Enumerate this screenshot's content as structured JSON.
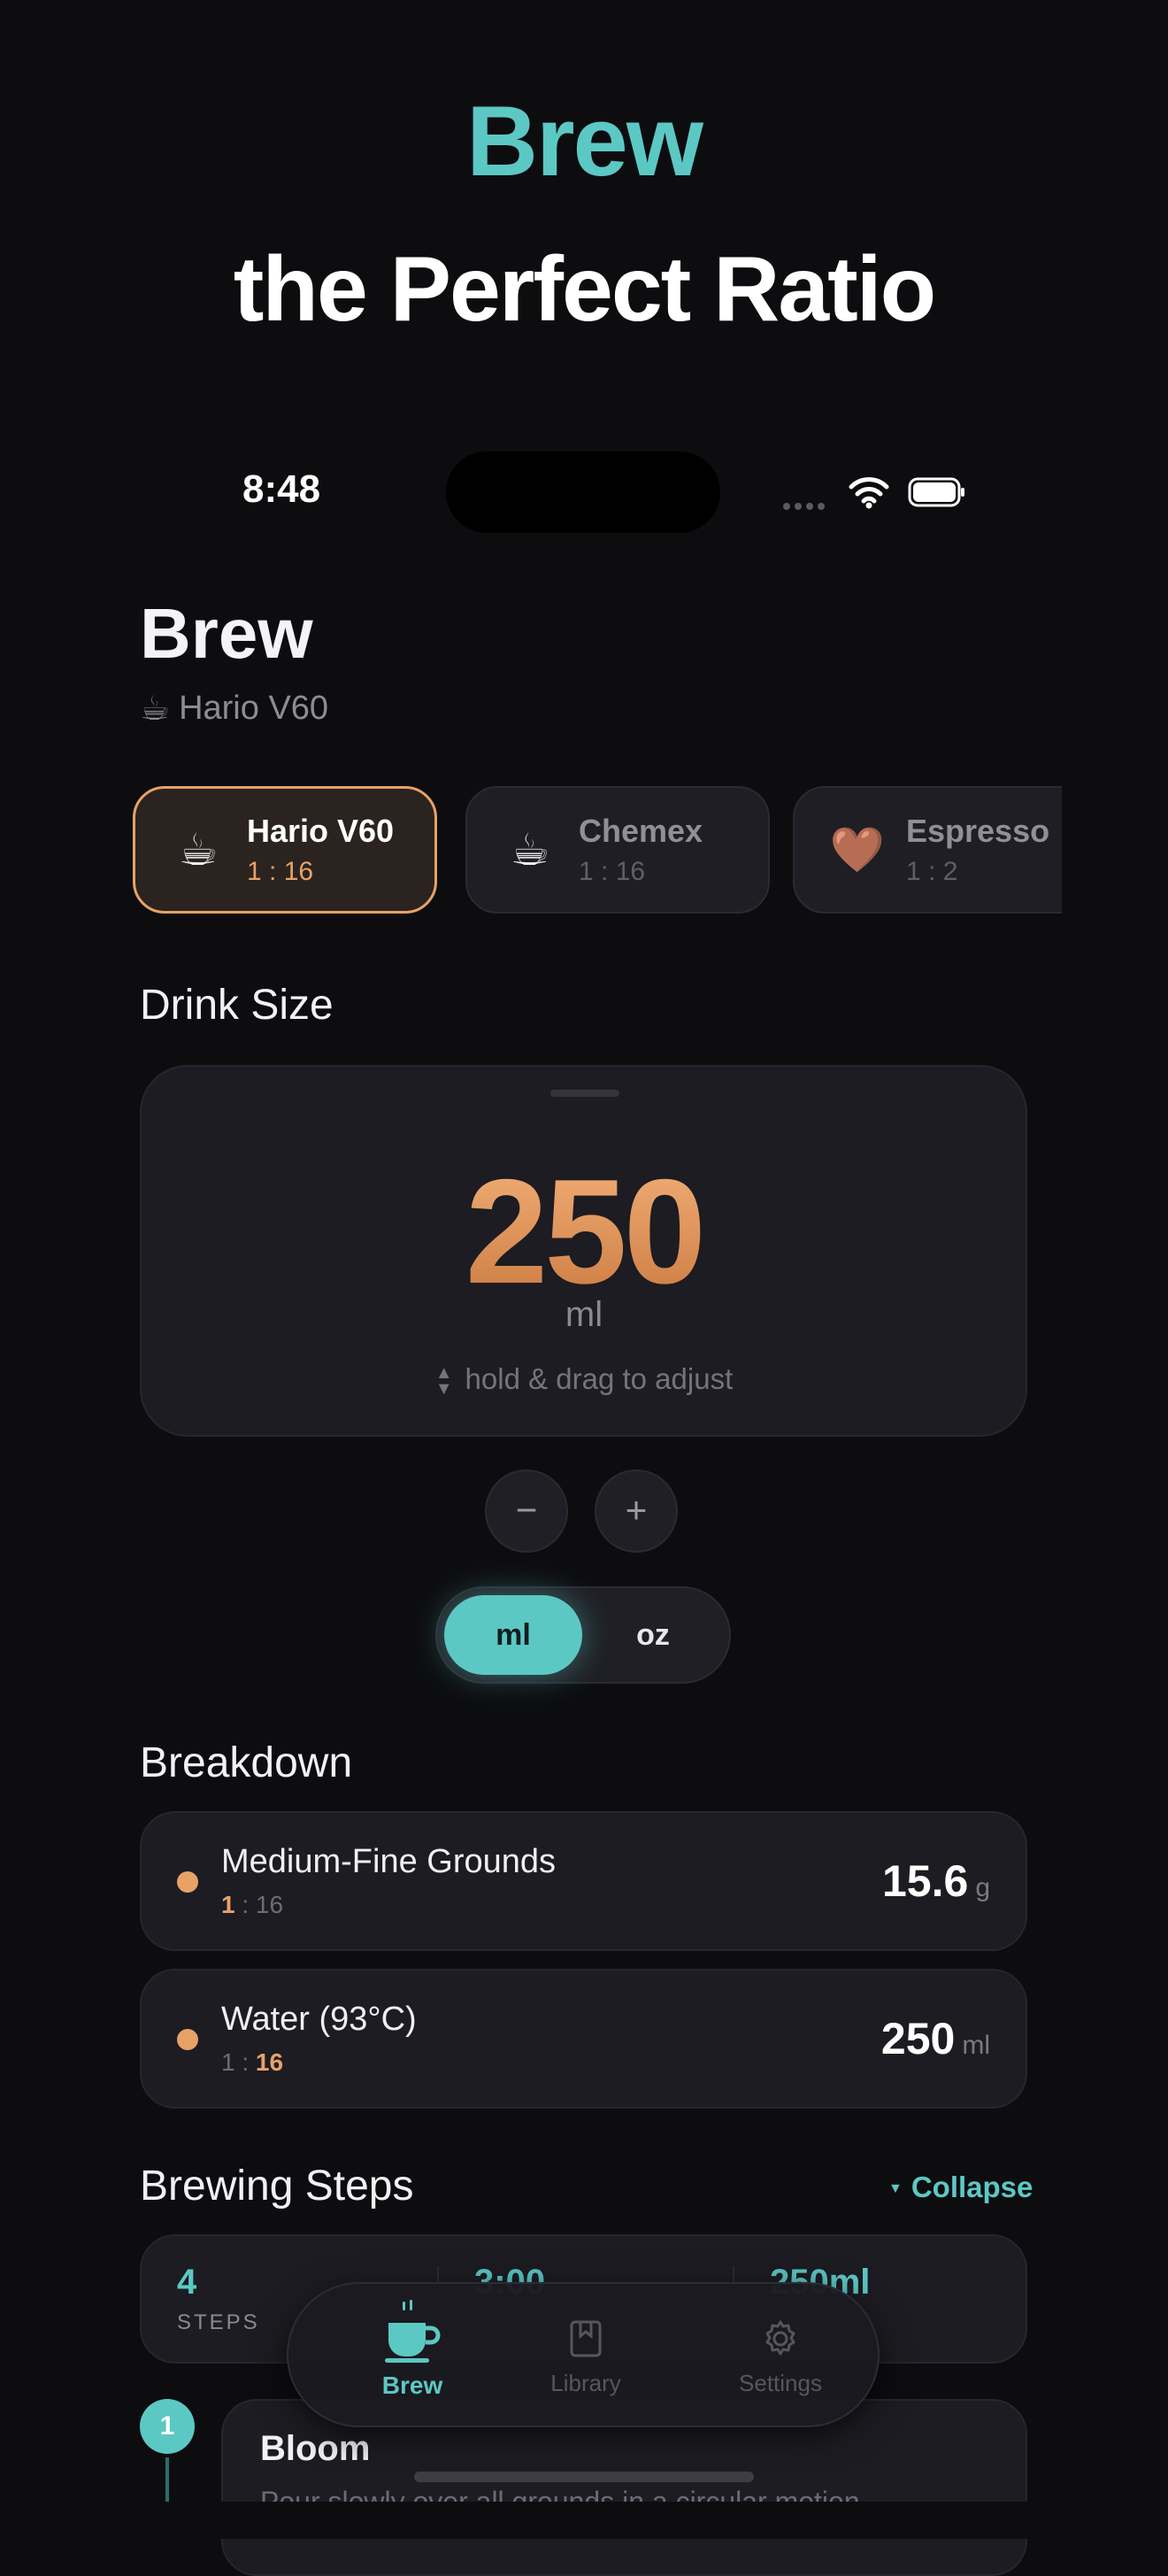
{
  "hero": {
    "line1": "Brew",
    "line2": "the Perfect Ratio"
  },
  "status": {
    "time": "8:48"
  },
  "header": {
    "title": "Brew",
    "subtitle_icon": "☕",
    "subtitle": "Hario V60"
  },
  "methods": [
    {
      "icon": "☕",
      "name": "Hario V60",
      "ratio": "1 : 16",
      "selected": true
    },
    {
      "icon": "☕",
      "name": "Chemex",
      "ratio": "1 : 16",
      "selected": false
    },
    {
      "icon": "🤎",
      "name": "Espresso",
      "ratio": "1 : 2",
      "selected": false
    }
  ],
  "drink_size": {
    "heading": "Drink Size",
    "value": "250",
    "unit": "ml",
    "hint": "hold & drag to adjust",
    "minus": "−",
    "plus": "+",
    "unit_options": [
      "ml",
      "oz"
    ],
    "selected_unit": "ml"
  },
  "breakdown": {
    "heading": "Breakdown",
    "items": [
      {
        "label": "Medium-Fine Grounds",
        "ratio_left": "1",
        "ratio_right": " : 16",
        "value": "15.6",
        "unit": "g"
      },
      {
        "label": "Water (93°C)",
        "ratio_left": "1 : ",
        "ratio_right": "16",
        "value": "250",
        "unit": "ml"
      }
    ]
  },
  "steps": {
    "heading": "Brewing Steps",
    "collapse": "Collapse",
    "stats": {
      "count": "4",
      "count_label": "STEPS",
      "time": "3:00",
      "water": "250ml"
    },
    "first": {
      "number": "1",
      "title": "Bloom",
      "desc": "Pour slowly over all grounds in a circular motion"
    }
  },
  "tabbar": {
    "items": [
      {
        "label": "Brew",
        "icon": "cup-icon",
        "active": true
      },
      {
        "label": "Library",
        "icon": "book-icon",
        "active": false
      },
      {
        "label": "Settings",
        "icon": "gear-icon",
        "active": false
      }
    ]
  },
  "colors": {
    "accent": "#5cc8c4",
    "highlight": "#e8a266",
    "background": "#0d0d10"
  }
}
